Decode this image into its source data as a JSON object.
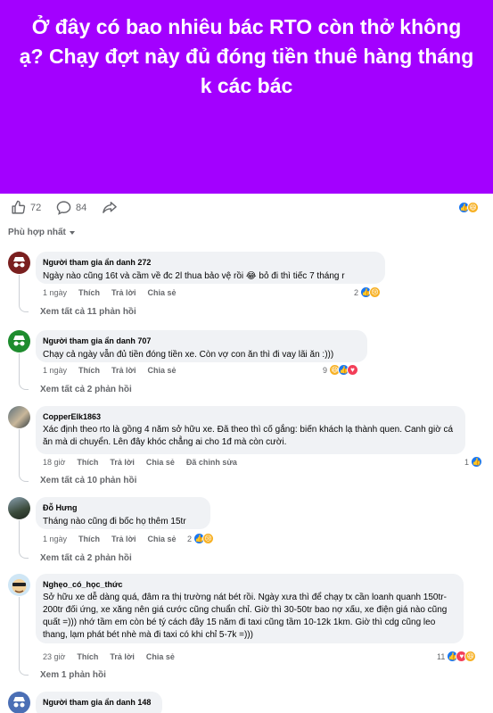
{
  "post": {
    "text": "Ở đây có bao nhiêu bác RTO còn thở không ạ? Chạy đợt này đủ đóng tiền thuê hàng tháng k các bác",
    "background_color": "#a300ff"
  },
  "stats": {
    "likes": "72",
    "comments": "84"
  },
  "sort_label": "Phù hợp nhất",
  "actions": {
    "like": "Thích",
    "reply": "Trả lời",
    "share": "Chia sẻ",
    "edited": "Đã chỉnh sửa"
  },
  "comments": [
    {
      "name": "Người tham gia ẩn danh 272",
      "text": "Ngày nào cũng 16t và cầm về đc 2l thua bảo vệ rồi 😂 bỏ đi thì tiếc 7 tháng r",
      "time": "1 ngày",
      "reactions": "2",
      "replies": "Xem tất cả 11 phản hồi"
    },
    {
      "name": "Người tham gia ẩn danh 707",
      "text": "Chạy cả ngày vẫn đủ tiền đóng tiền xe. Còn vợ con ăn thì đi vay lãi ăn :)))",
      "time": "1 ngày",
      "reactions": "9",
      "replies": "Xem tất cả 2 phản hồi"
    },
    {
      "name": "CopperElk1863",
      "text": "Xác định theo rto là gồng 4 năm sở hữu xe. Đã theo thì cố gắng: biến khách lạ thành quen. Canh giờ cá ăn mà di chuyển. Lên đây khóc chẳng ai cho 1đ mà còn cười.",
      "time": "18 giờ",
      "reactions": "1",
      "replies": "Xem tất cả 10 phản hồi"
    },
    {
      "name": "Đỗ Hưng",
      "text": "Tháng nào cũng đi bốc họ thêm 15tr",
      "time": "1 ngày",
      "reactions": "2",
      "replies": "Xem tất cả 2 phản hồi"
    },
    {
      "name": "Nghẹo_có_học_thức",
      "text": "Sở hữu xe dễ dàng quá, đâm ra thị trường nát bét rồi. Ngày xưa thì để chạy tx cần loanh quanh 150tr-200tr đối ứng, xe xăng nên giá cước cũng chuẩn chỉ. Giờ thì 30-50tr bao nợ xấu, xe điện giá nào cũng quất =))) nhớ tầm em còn bé tý cách đây 15 năm đi taxi cũng tầm 10-12k 1km. Giờ thì cdg cũng leo thang, lạm phát bét nhè mà đi taxi có khi chỉ 5-7k =)))",
      "time": "23 giờ",
      "reactions": "11",
      "replies": "Xem 1 phản hồi"
    },
    {
      "name": "Người tham gia ẩn danh 148"
    }
  ]
}
